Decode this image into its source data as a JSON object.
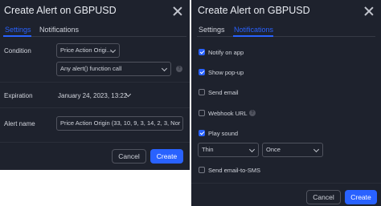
{
  "dialog_settings": {
    "title": "Create Alert on GBPUSD",
    "tabs": [
      {
        "label": "Settings",
        "active": true
      },
      {
        "label": "Notifications",
        "active": false
      }
    ],
    "condition": {
      "label": "Condition",
      "source_value": "Price Action Origi...",
      "trigger_value": "Any alert() function call"
    },
    "expiration": {
      "label": "Expiration",
      "value": "January 24, 2023, 13:22"
    },
    "alert_name": {
      "label": "Alert name",
      "value": "Price Action Origin (33, 10, 9, 3, 14, 2, 3, Nor"
    },
    "buttons": {
      "cancel": "Cancel",
      "create": "Create"
    }
  },
  "dialog_notifications": {
    "title": "Create Alert on GBPUSD",
    "tabs": [
      {
        "label": "Settings",
        "active": false
      },
      {
        "label": "Notifications",
        "active": true
      }
    ],
    "options": [
      {
        "label": "Notify on app",
        "checked": true
      },
      {
        "label": "Show pop-up",
        "checked": true
      },
      {
        "label": "Send email",
        "checked": false
      },
      {
        "label": "Webhook URL",
        "checked": false
      },
      {
        "label": "Play sound",
        "checked": true
      },
      {
        "label": "Send email-to-SMS",
        "checked": false
      }
    ],
    "sound": {
      "sound_value": "Thin",
      "repeat_value": "Once"
    },
    "buttons": {
      "cancel": "Cancel",
      "create": "Create"
    }
  },
  "colors": {
    "panel_bg": "#1e222d",
    "accent": "#2962ff",
    "text": "#d1d4dc",
    "border": "#50535e"
  }
}
